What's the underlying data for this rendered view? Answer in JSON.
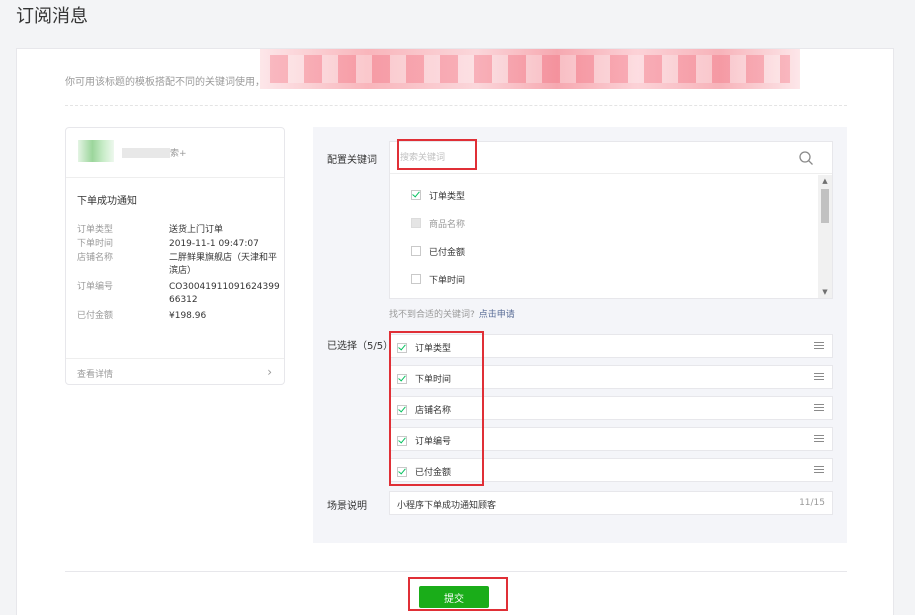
{
  "page": {
    "title": "订阅消息"
  },
  "description": "你可用该标题的模板搭配不同的关键词使用，",
  "preview": {
    "head_suffix": "索+",
    "title": "下单成功通知",
    "fields": [
      {
        "key": "订单类型",
        "value": "送货上门订单"
      },
      {
        "key": "下单时间",
        "value": "2019-11-1 09:47:07"
      },
      {
        "key": "店铺名称",
        "value": "二胖鲜果旗舰店（天津和平滨店）"
      },
      {
        "key": "订单编号",
        "value": "CO30041911091624399 66312"
      },
      {
        "key": "已付金额",
        "value": "¥198.96"
      }
    ],
    "detail_link": "查看详情"
  },
  "config": {
    "keywords_label": "配置关键词",
    "search_placeholder": "搜索关键词",
    "keywords": [
      {
        "label": "订单类型",
        "state": "checked"
      },
      {
        "label": "商品名称",
        "state": "disabled"
      },
      {
        "label": "已付金额",
        "state": "unchecked"
      },
      {
        "label": "下单时间",
        "state": "unchecked"
      }
    ],
    "hint_text": "找不到合适的关键词?",
    "hint_link": "点击申请",
    "selected_label": "已选择（5/5）",
    "selected": [
      "订单类型",
      "下单时间",
      "店铺名称",
      "订单编号",
      "已付金额"
    ],
    "scene_label": "场景说明",
    "scene_value": "小程序下单成功通知顾客",
    "scene_count": "11/15"
  },
  "submit_label": "提交",
  "colors": {
    "accent": "#1aad19",
    "check": "#07c160",
    "link": "#576b95",
    "highlight": "#e02f36"
  },
  "icons": {
    "search": "search-icon",
    "drag": "drag-handle-icon",
    "chevron": "chevron-right-icon"
  }
}
